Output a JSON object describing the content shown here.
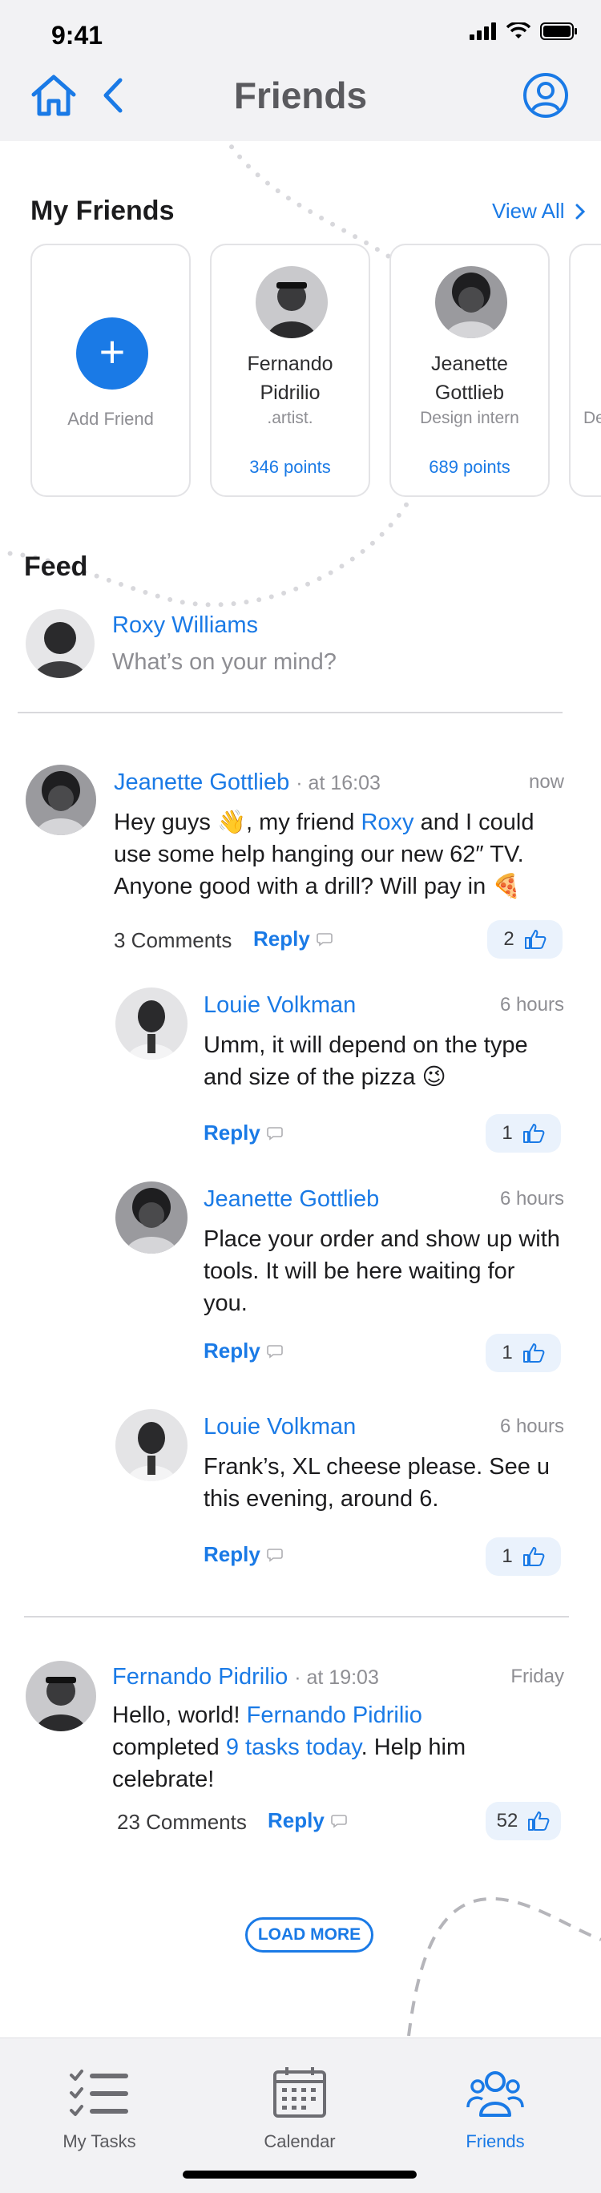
{
  "status": {
    "time": "9:41"
  },
  "header": {
    "title": "Friends"
  },
  "friends": {
    "title": "My Friends",
    "view_all": "View All",
    "add_label": "Add Friend",
    "cards": [
      {
        "name_line1": "Fernando",
        "name_line2": "Pidrilio",
        "role": ".artist.",
        "points": "346 points"
      },
      {
        "name_line1": "Jeanette",
        "name_line2": "Gottlieb",
        "role": "Design intern",
        "points": "689 points"
      }
    ],
    "partial_role": "De"
  },
  "feed": {
    "title": "Feed",
    "composer": {
      "name": "Roxy Williams",
      "placeholder": "What’s on your mind?"
    },
    "post1": {
      "author": "Jeanette Gottlieb",
      "at": "· at 16:03",
      "time": "now",
      "text_a": "Hey guys 👋, my friend ",
      "mention": "Roxy",
      "text_b": " and I could use some help hanging our new 62″ TV. Anyone good with a drill? Will pay in 🍕",
      "comments": "3 Comments",
      "reply": "Reply",
      "likes": "2"
    },
    "replies": [
      {
        "author": "Louie Volkman",
        "time": "6 hours",
        "text": "Umm, it will depend on the type and size of the pizza 😉",
        "reply": "Reply",
        "likes": "1"
      },
      {
        "author": "Jeanette Gottlieb",
        "time": "6 hours",
        "text": "Place your order and show up with tools. It will be here waiting for you.",
        "reply": "Reply",
        "likes": "1"
      },
      {
        "author": "Louie Volkman",
        "time": "6 hours",
        "text": "Frank’s, XL cheese please. See u this evening, around 6.",
        "reply": "Reply",
        "likes": "1"
      }
    ],
    "post2": {
      "author": "Fernando Pidrilio",
      "at": "· at 19:03",
      "time": "Friday",
      "text_a": "Hello, world! ",
      "mention": "Fernando Pidrilio",
      "text_b": " completed ",
      "link": "9 tasks today",
      "text_c": ". Help him celebrate!",
      "comments": "23 Comments",
      "reply": "Reply",
      "likes": "52"
    },
    "load_more": "LOAD MORE"
  },
  "tabs": [
    {
      "label": "My Tasks",
      "icon": "checklist-icon"
    },
    {
      "label": "Calendar",
      "icon": "calendar-icon"
    },
    {
      "label": "Friends",
      "icon": "friends-icon"
    }
  ],
  "colors": {
    "accent": "#1a7ae6",
    "background": "#f2f2f4"
  }
}
